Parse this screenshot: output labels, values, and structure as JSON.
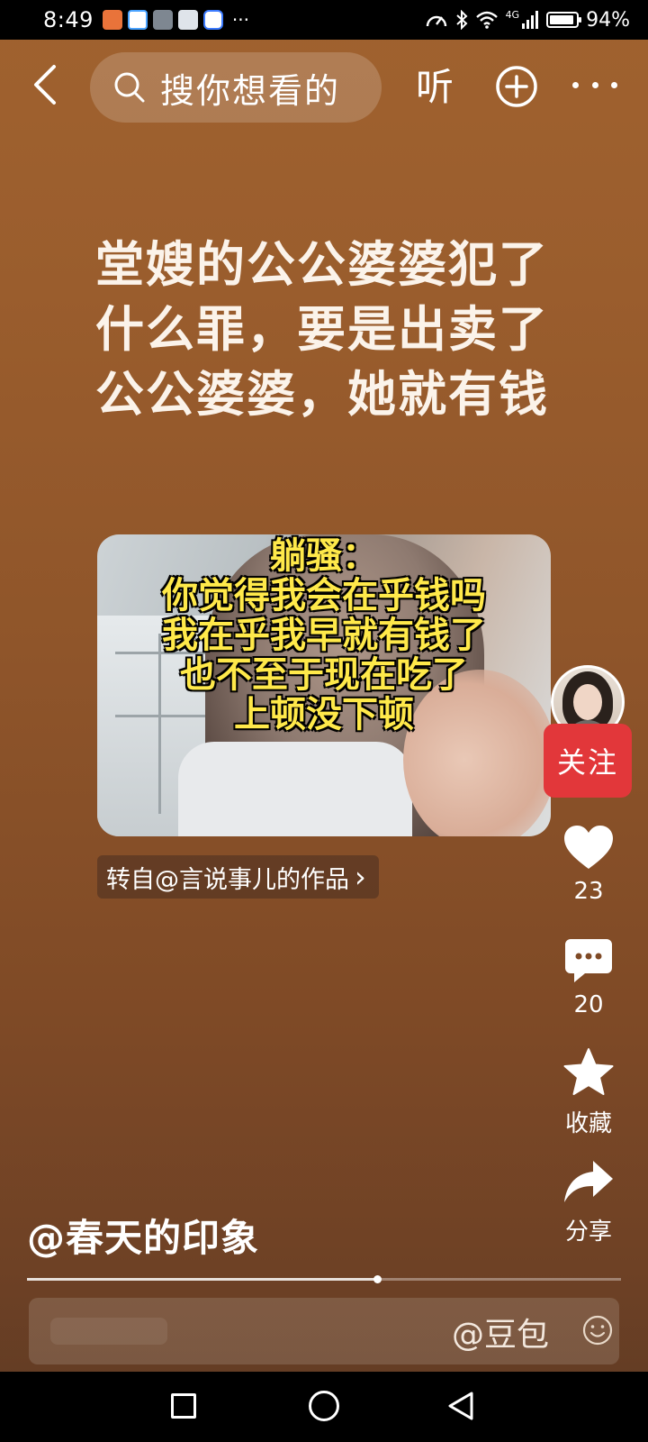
{
  "status_bar": {
    "time": "8:49",
    "more_indicator": "···",
    "network": "4G",
    "battery_percent": "94%",
    "battery_level": 0.94,
    "icons": [
      "speed-icon",
      "bluetooth-icon",
      "wifi-icon",
      "signal-icon"
    ]
  },
  "top_nav": {
    "search_placeholder": "搜你想看的",
    "listen_label": "听"
  },
  "post": {
    "text_lines": [
      "堂嫂的公公婆婆犯了",
      "什么罪，要是出卖了",
      "公公婆婆，她就有钱"
    ]
  },
  "video": {
    "captions": [
      "躺骚：",
      "你觉得我会在乎钱吗",
      "我在乎我早就有钱了",
      "也不至于现在吃了",
      "上顿没下顿"
    ]
  },
  "repost": {
    "label": "转自@言说事儿的作品",
    "chevron": "›"
  },
  "actions": {
    "follow_label": "关注",
    "like_count": "23",
    "comment_count": "20",
    "favorite_label": "收藏",
    "share_label": "分享"
  },
  "author": {
    "name": "@春天的印象"
  },
  "progress": {
    "fraction": 0.59
  },
  "comment_bar": {
    "mention_label": "@豆包"
  },
  "colors": {
    "background": "#8f552a",
    "follow_button": "#e2373a",
    "caption_yellow": "#ffe94a"
  }
}
